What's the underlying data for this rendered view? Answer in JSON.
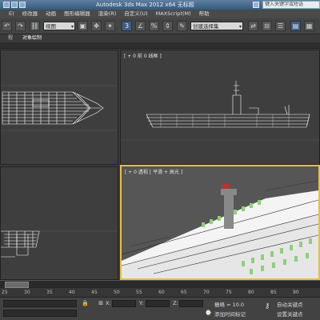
{
  "window": {
    "title": "Autodesk 3ds Max  2012 x64     无标题",
    "search_placeholder": "键入关键字或短语"
  },
  "menu": [
    "E)",
    "修改器",
    "动画",
    "图形编辑器",
    "渲染(R)",
    "自定义(U)",
    "MAXScript(M)",
    "帮助"
  ],
  "toolbar": {
    "view_dropdown": "视图",
    "selection_set_dropdown": "创建选择集",
    "angle_snap_label": "3"
  },
  "ribbon": {
    "tabs": [
      "程",
      "对象绘制"
    ]
  },
  "viewports": {
    "top": {
      "label": ""
    },
    "front": {
      "label": "[ + 0 前 0 线框 ]"
    },
    "left": {
      "label": ""
    },
    "perspective": {
      "label": "[ + 0 透视 [ 平滑 + 高光 ]"
    }
  },
  "timeline": {
    "ticks": [
      "25",
      "30",
      "35",
      "40",
      "45",
      "50",
      "55",
      "60",
      "65",
      "70",
      "75",
      "80",
      "85",
      "90"
    ]
  },
  "status": {
    "grid_label": "栅格 = 10.0",
    "auto_key_label": "自动关键点",
    "set_key_label": "设置关键点",
    "add_time_tag_label": "添加时间标记"
  },
  "colors": {
    "active_viewport_border": "#e8c040",
    "wire_color": "#ffffff",
    "deck_green": "#8fcf7a"
  }
}
